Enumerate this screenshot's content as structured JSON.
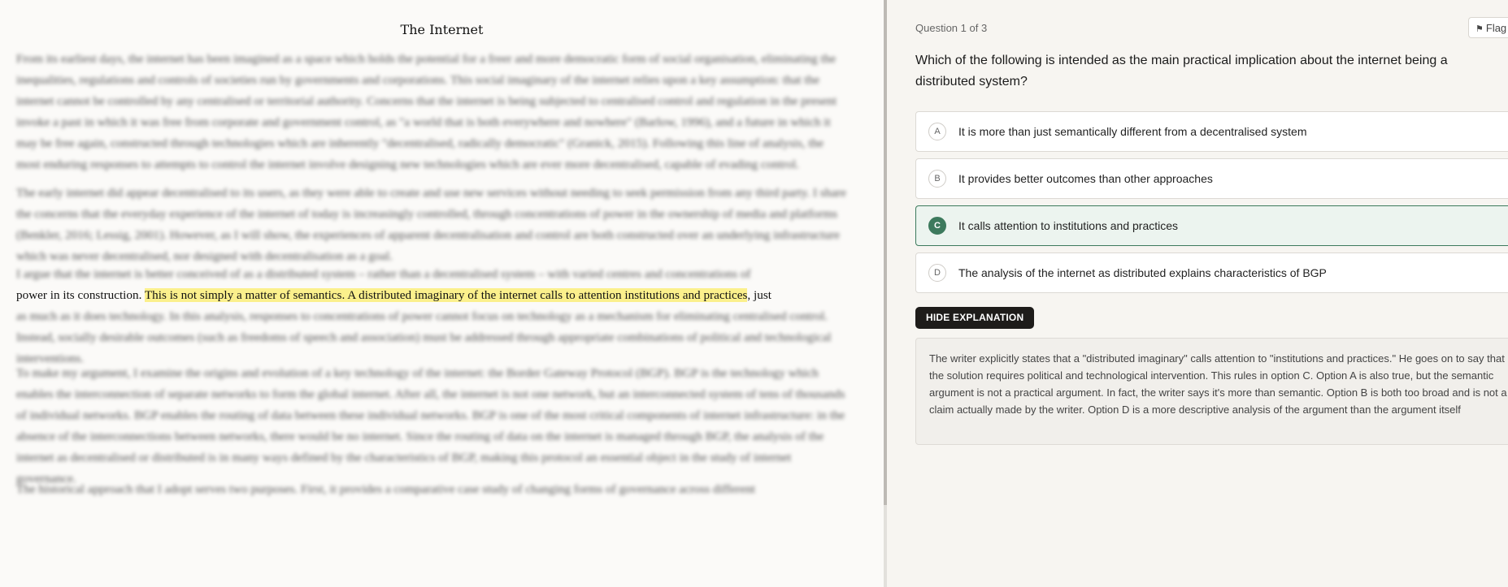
{
  "passage": {
    "title": "The Internet",
    "p1": "From its earliest days, the internet has been imagined as a space which holds the potential for a freer and more democratic form of social organisation, eliminating the inequalities, regulations and controls of societies run by governments and corporations. This social imaginary of the internet relies upon a key assumption: that the internet cannot be controlled by any centralised or territorial authority. Concerns that the internet is being subjected to centralised control and regulation in the present invoke a past in which it was free from corporate and government control, as \"a world that is both everywhere and nowhere\" (Barlow, 1996), and a future in which it may be free again, constructed through technologies which are inherently \"decentralised, radically democratic\" (Granick, 2015). Following this line of analysis, the most enduring responses to attempts to control the internet involve designing new technologies which are ever more decentralised, capable of evading control.",
    "p2": "The early internet did appear decentralised to its users, as they were able to create and use new services without needing to seek permission from any third party. I share the concerns that the everyday experience of the internet of today is increasingly controlled, through concentrations of power in the ownership of media and platforms (Benkler, 2016; Lessig, 2001). However, as I will show, the experiences of apparent decentralisation and control are both constructed over an underlying infrastructure which was never decentralised, nor designed with decentralisation as a goal.",
    "p3_line1": "I argue that the internet is better conceived of as a distributed system – rather than a decentralised system – with varied centres and concentrations of",
    "p3_clear_before": "power in its construction. ",
    "p3_highlight": "This is not simply a matter of semantics. A distributed imaginary of the internet calls to attention institutions and practices",
    "p3_clear_after": ", just",
    "p3_line3": "as much as it does technology. In this analysis, responses to concentrations of power cannot focus on technology as a mechanism for eliminating centralised control. Instead, socially desirable outcomes (such as freedoms of speech and association) must be addressed through appropriate combinations of political and technological interventions.",
    "p4": "To make my argument, I examine the origins and evolution of a key technology of the internet: the Border Gateway Protocol (BGP). BGP is the technology which enables the interconnection of separate networks to form the global internet. After all, the internet is not one network, but an interconnected system of tens of thousands of individual networks. BGP enables the routing of data between these individual networks. BGP is one of the most critical components of internet infrastructure: in the absence of the interconnections between networks, there would be no internet. Since the routing of data on the internet is managed through BGP, the analysis of the internet as decentralised or distributed is in many ways defined by the characteristics of BGP, making this protocol an essential object in the study of internet governance.",
    "p5": "The historical approach that I adopt serves two purposes. First, it provides a comparative case study of changing forms of governance across different"
  },
  "question_panel": {
    "counter": "Question 1 of 3",
    "flag_label": "Flag",
    "question": "Which of the following is intended as the main practical implication about the internet being a distributed system?",
    "options": [
      {
        "letter": "A",
        "text": "It is more than just semantically different from a decentralised system"
      },
      {
        "letter": "B",
        "text": "It provides better outcomes than other approaches"
      },
      {
        "letter": "C",
        "text": "It calls attention to institutions and practices"
      },
      {
        "letter": "D",
        "text": "The analysis of the internet as distributed explains characteristics of BGP"
      }
    ],
    "selected": "C",
    "hide_explanation_label": "HIDE EXPLANATION",
    "explanation": "The writer explicitly states that a \"distributed imaginary\" calls attention to \"institutions and practices.\" He goes on to say that the solution requires political and technological intervention. This rules in option C. Option A is also true, but the semantic argument is not a practical argument. In fact, the writer says it's more than semantic. Option B is both too broad and is not a claim actually made by the writer. Option D is a more descriptive analysis of the argument than the argument itself"
  },
  "colors": {
    "selected_green": "#3d7a5d",
    "highlight_yellow": "#fbf08c",
    "button_dark": "#1e1c1a"
  }
}
